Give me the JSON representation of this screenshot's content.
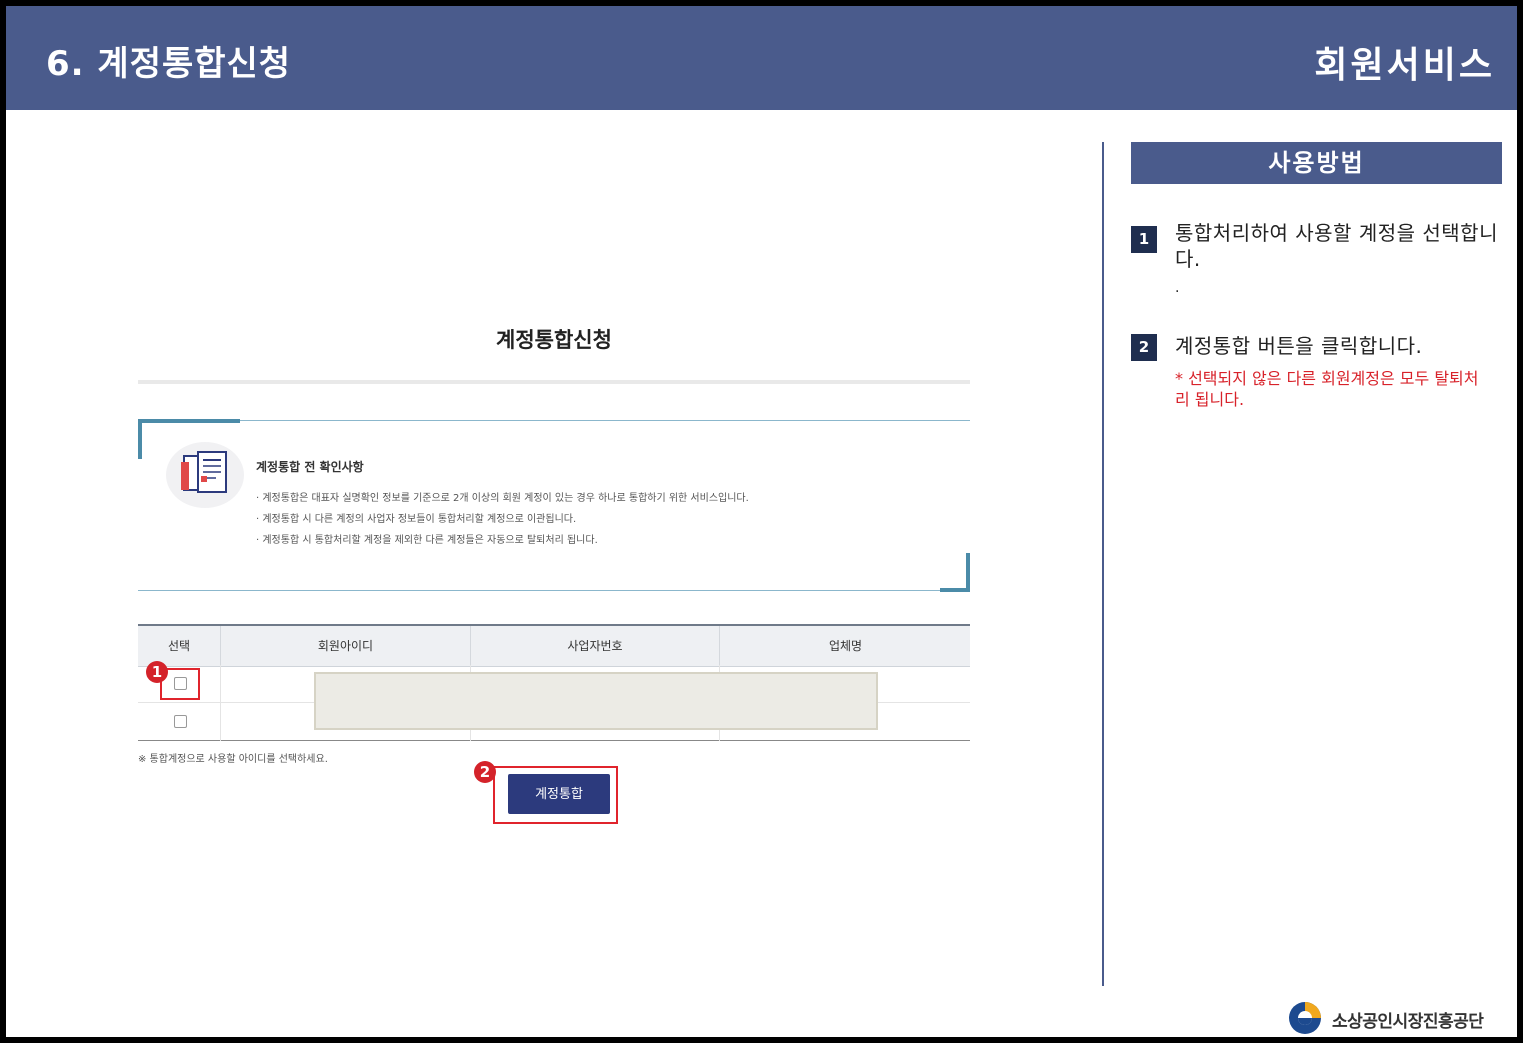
{
  "header": {
    "title": "6. 계정통합신청",
    "service": "회원서비스"
  },
  "screenshot": {
    "page_title": "계정통합신청",
    "notice_title": "계정통합 전 확인사항",
    "notice_items": [
      "· 계정통합은 대표자 실명확인 정보를 기준으로 2개 이상의 회원 계정이 있는 경우 하나로 통합하기 위한 서비스입니다.",
      "· 계정통합 시 다른 계정의 사업자 정보들이 통합처리할 계정으로 이관됩니다.",
      "· 계정통합 시 통합처리할 계정을 제외한 다른 계정들은 자동으로 탈퇴처리 됩니다."
    ],
    "table_headers": [
      "선택",
      "회원아이디",
      "사업자번호",
      "업체명"
    ],
    "table_note": "※ 통합계정으로 사용할 아이디를 선택하세요.",
    "merge_button": "계정통합",
    "badge_1": "1",
    "badge_2": "2"
  },
  "usage": {
    "title": "사용방법",
    "steps": [
      {
        "num": "1",
        "text": "통합처리하여 사용할 계정을 선택합니다.",
        "dot": "."
      },
      {
        "num": "2",
        "text": "계정통합 버튼을 클릭합니다.",
        "warning": "* 선택되지 않은 다른 회원계정은 모두 탈퇴처리 됩니다."
      }
    ]
  },
  "logo": {
    "text": "소상공인시장진흥공단"
  },
  "colors": {
    "header_bg": "#4a5b8c",
    "step_badge_bg": "#1f2e4f",
    "warning_red": "#d8222a",
    "button_navy": "#2c3a7d"
  }
}
